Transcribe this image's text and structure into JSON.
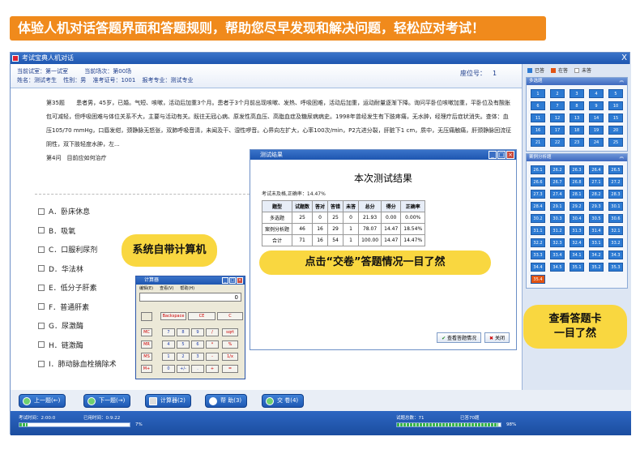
{
  "banner": "体验人机对话答题界面和答题规则，帮助您尽早发现和解决问题，轻松应对考试！",
  "window": {
    "title": "考试宝典人机对话",
    "close": "X"
  },
  "info": {
    "room": "当前试室：第一试室",
    "session": "当前场次：第00场",
    "name": "姓名：测试考生",
    "gender": "性别：男",
    "ticket": "准考证号：1001",
    "subject": "报考专业：测试专业",
    "seat_label": "座位号：",
    "seat_no": "1"
  },
  "question": {
    "number": "第35题",
    "text": "患者男，45岁，已婚。气短、咳嗽，活动后加重3个月。患者于3个月前出现咳嗽、发热、呼吸困难，活动后加重，运动耐量逐渐下降。询问平卧位咳嗽加重，平卧位及有酸胀包可减轻，但呼吸困难与体位关系不大，主要与活动有关。既往无冠心病、原发性高血压、高脂血症及糖尿病病史。1998年曾经发生有下肢疼痛，无水肿，经理疗后症状消失。查体：血压105/70 mmHg，口唇发绀，颈静脉无怒张，双肺呼吸音清，未闻及干、湿性啰音。心界向左扩大，心率100次/min，P2亢进分裂，肝脏下1 cm，质中，无压痛触痛，肝颈静脉回流征阴性，双下肢轻度水肿，左...",
    "prompt": "第4问　目前应如何治疗"
  },
  "options": [
    "A．卧床休息",
    "B．吸氧",
    "C．口服利尿剂",
    "D．华法林",
    "E．低分子肝素",
    "F．普通肝素",
    "G．尿激酶",
    "H．链激酶",
    "I．肺动脉血栓摘除术"
  ],
  "callouts": {
    "calc": "系统自带计算机",
    "submit": "点击“交卷”答题情况一目了然",
    "card_line1": "查看答题卡",
    "card_line2": "一目了然"
  },
  "result": {
    "title": "测试结果",
    "heading": "本次测试结果",
    "summary": "考试未及格,正确率：14.47%",
    "headers": [
      "题型",
      "试题数",
      "答对",
      "答错",
      "未答",
      "总分",
      "得分",
      "正确率"
    ],
    "rows": [
      [
        "多选题",
        "25",
        "0",
        "25",
        "0",
        "21.93",
        "0.00",
        "0.00%"
      ],
      [
        "案例分析题",
        "46",
        "16",
        "29",
        "1",
        "78.07",
        "14.47",
        "18.54%"
      ],
      [
        "合计",
        "71",
        "16",
        "54",
        "1",
        "100.00",
        "14.47",
        "14.47%"
      ]
    ],
    "view_btn": "查看答题情况",
    "close_btn": "关闭"
  },
  "calculator": {
    "title": "计算器",
    "menu": [
      "编辑(E)",
      "查看(V)",
      "帮助(H)"
    ],
    "display": "0",
    "top_keys": [
      "Backspace",
      "CE",
      "C"
    ],
    "rows": [
      [
        "MC",
        "7",
        "8",
        "9",
        "/",
        "sqrt"
      ],
      [
        "MR",
        "4",
        "5",
        "6",
        "*",
        "%"
      ],
      [
        "MS",
        "1",
        "2",
        "3",
        "-",
        "1/x"
      ],
      [
        "M+",
        "0",
        "+/-",
        ".",
        "+",
        "="
      ]
    ]
  },
  "side": {
    "legend": [
      "已答",
      "在答",
      "未答"
    ],
    "legend_colors": [
      "#2c7ad3",
      "#e25312",
      "#ffffff"
    ],
    "multi_title": "多选题",
    "multi_items": [
      "1",
      "2",
      "3",
      "4",
      "5",
      "6",
      "7",
      "8",
      "9",
      "10",
      "11",
      "12",
      "13",
      "14",
      "15",
      "16",
      "17",
      "18",
      "19",
      "20",
      "21",
      "22",
      "23",
      "24",
      "25"
    ],
    "case_title": "案例分析题",
    "case_items": [
      "26.1",
      "26.2",
      "26.3",
      "26.4",
      "26.5",
      "26.6",
      "26.7",
      "26.8",
      "27.1",
      "27.2",
      "27.3",
      "27.4",
      "28.1",
      "28.2",
      "28.3",
      "28.4",
      "29.1",
      "29.2",
      "29.3",
      "30.1",
      "30.2",
      "30.3",
      "30.4",
      "30.5",
      "30.6",
      "31.1",
      "31.2",
      "31.3",
      "31.4",
      "32.1",
      "32.2",
      "32.3",
      "32.4",
      "33.1",
      "33.2",
      "33.3",
      "33.4",
      "34.1",
      "34.2",
      "34.3",
      "34.4",
      "34.5",
      "35.1",
      "35.2",
      "35.3",
      "35.4"
    ]
  },
  "toolbar": {
    "prev": "上一题(←)",
    "next": "下一题(→)",
    "calc": "计算器(2)",
    "help": "帮 助(3)",
    "submit": "交 卷(4)"
  },
  "status": {
    "exam_time": "考试时间：2:00:0",
    "used_time": "已用时间：0:9:22",
    "time_pct": "7%",
    "time_fraction": 0.07,
    "total": "试题总数：71",
    "answered": "已答70题",
    "answered_pct": "98%",
    "answered_fraction": 0.98
  }
}
